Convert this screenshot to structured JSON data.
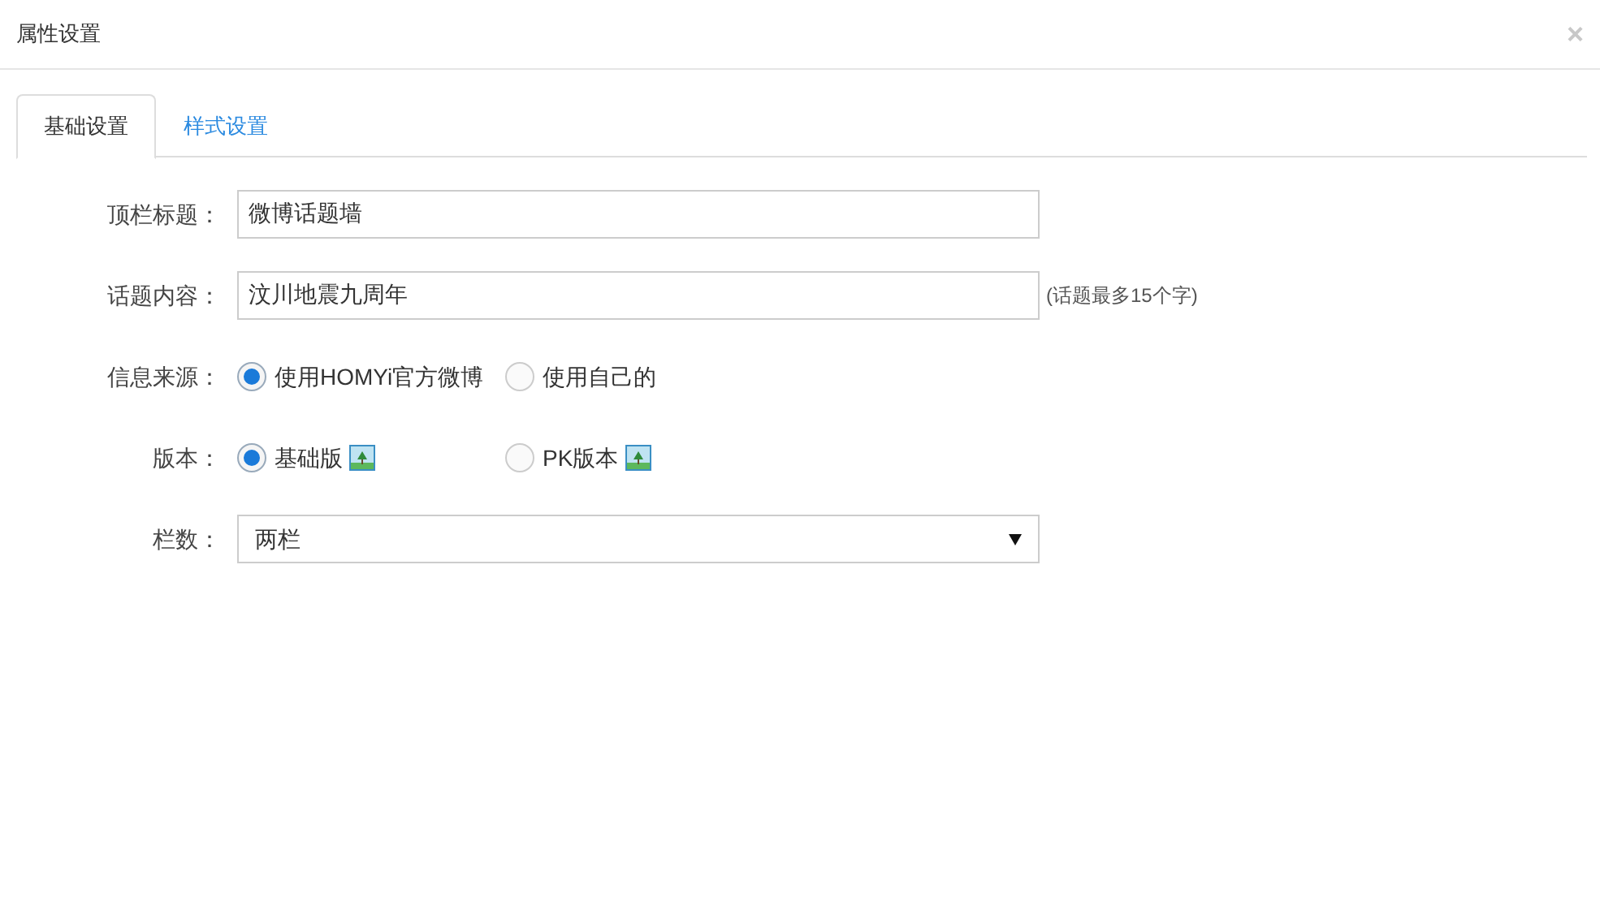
{
  "dialog": {
    "title": "属性设置",
    "close": "×"
  },
  "tabs": [
    {
      "label": "基础设置",
      "selected": true
    },
    {
      "label": "样式设置",
      "selected": false
    }
  ],
  "fields": [
    {
      "kind": "text",
      "label": "顶栏标题：",
      "value": "微博话题墙"
    },
    {
      "kind": "text",
      "label": "话题内容：",
      "value": "汶川地震九周年",
      "hint": "(话题最多15个字)"
    },
    {
      "kind": "radio",
      "label": "信息来源：",
      "options": [
        {
          "label": "使用HOMYi官方微博",
          "selected": true,
          "preview": false
        },
        {
          "label": "使用自己的",
          "selected": false,
          "preview": false
        }
      ]
    },
    {
      "kind": "radio",
      "label": "版本：",
      "options": [
        {
          "label": "基础版",
          "selected": true,
          "preview": true
        },
        {
          "label": "PK版本",
          "selected": false,
          "preview": true
        }
      ]
    },
    {
      "kind": "select",
      "label": "栏数：",
      "value": "两栏"
    }
  ]
}
